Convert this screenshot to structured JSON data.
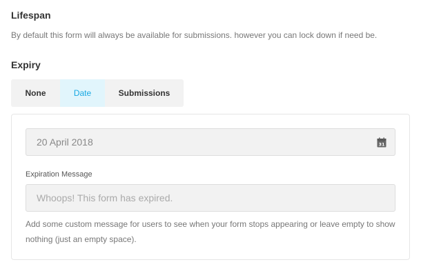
{
  "lifespan": {
    "title": "Lifespan",
    "description": "By default this form will always be available for submissions. however you can lock down if need be."
  },
  "expiry": {
    "title": "Expiry",
    "tabs": [
      {
        "label": "None",
        "active": false
      },
      {
        "label": "Date",
        "active": true
      },
      {
        "label": "Submissions",
        "active": false
      }
    ]
  },
  "date_field": {
    "value": "20 April 2018",
    "icon": "calendar-icon",
    "icon_day": "31"
  },
  "message_field": {
    "label": "Expiration Message",
    "placeholder": "Whoops! This form has expired.",
    "help": "Add some custom message for users to see when your form stops appearing or leave empty to show nothing (just an empty space)."
  },
  "colors": {
    "accent": "#17a8e3",
    "active_tab_bg": "#e1f5fc",
    "tab_bg": "#f2f2f2",
    "input_bg": "#f2f2f2"
  }
}
